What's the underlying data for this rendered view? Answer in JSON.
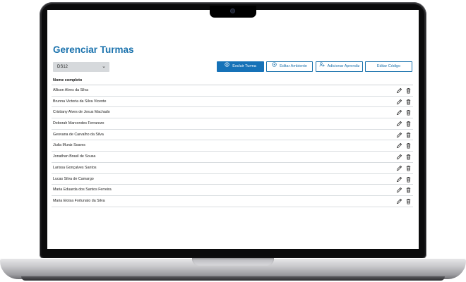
{
  "page": {
    "title": "Gerenciar Turmas"
  },
  "class_select": {
    "value": "DS12"
  },
  "toolbar": {
    "buttons": [
      {
        "label": "Excluir Turma",
        "icon": "close-circle-icon"
      },
      {
        "label": "Editar Ambiente",
        "icon": "info-circle-icon"
      },
      {
        "label": "Adicionar Aprendiz",
        "icon": "add-user-icon"
      },
      {
        "label": "Editar Código",
        "icon": ""
      }
    ]
  },
  "table": {
    "header": "Nome completo",
    "rows": [
      "Allison Alves da Silva",
      "Brunna Victoria da Silva Vicente",
      "Cristiany Alves de Jesus Machado",
      "Deborah Marcondes Ferrarezo",
      "Geovana de Carvalho da Silva",
      "Jiulia Muniz Soares",
      "Jonathan Brasil de Sousa",
      "Larissa Gonçalves Santos",
      "Lucas Silva de Camargo",
      "Maria Eduarda dos Santos Ferreira",
      "Maria Eloisa Fortunato da Silva"
    ],
    "row_actions": [
      "pencil-icon",
      "trash-icon"
    ]
  },
  "colors": {
    "accent": "#1a72ad",
    "primary_button": "#1672b8"
  }
}
